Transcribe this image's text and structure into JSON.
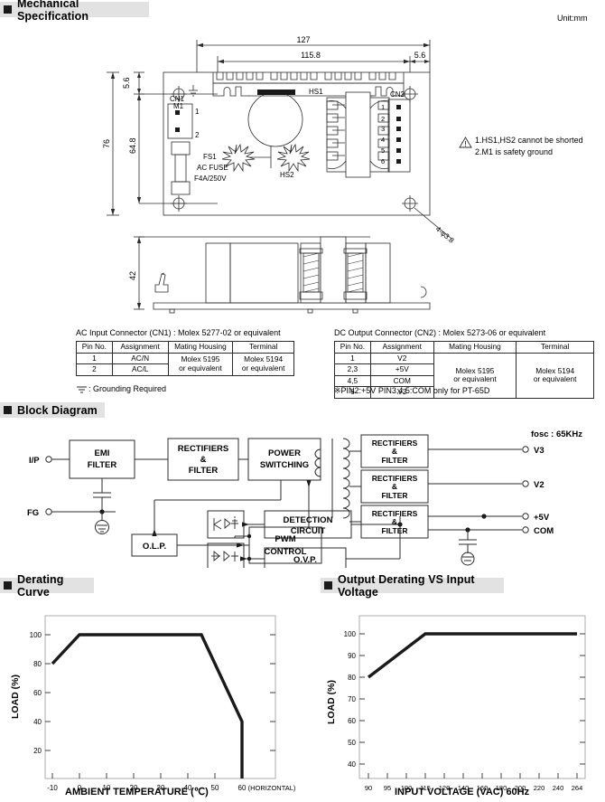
{
  "sections": {
    "mechanical": "Mechanical Specification",
    "block": "Block Diagram",
    "derating": "Derating Curve",
    "output_derating": "Output Derating VS Input Voltage"
  },
  "mechanical": {
    "unit_note": "Unit:mm",
    "dimensions": {
      "overall_width": "127",
      "inner_width": "115.8",
      "right_offset": "5.6",
      "top_offset": "5.6",
      "overall_height": "76",
      "inner_height": "64.8",
      "side_height": "42"
    },
    "labels": {
      "m1": "M1",
      "hs1": "HS1",
      "hs2": "HS2",
      "cn1": "CN1",
      "cn2": "CN2",
      "fs1": "FS1",
      "fuse_line1": "AC FUSE",
      "fuse_line2": "F4A/250V",
      "hole_callout": "4-φ3.8"
    },
    "cn1_pins": [
      "1",
      "2"
    ],
    "cn2_pins": [
      "1",
      "2",
      "3",
      "4",
      "5",
      "6"
    ],
    "warnings": [
      "1.HS1,HS2 cannot be shorted",
      "2.M1 is safety ground"
    ]
  },
  "cn1_table": {
    "caption": "AC Input Connector (CN1) : Molex 5277-02  or equivalent",
    "headers": [
      "Pin No.",
      "Assignment",
      "Mating Housing",
      "Terminal"
    ],
    "rows": [
      {
        "pin": "1",
        "assignment": "AC/N"
      },
      {
        "pin": "2",
        "assignment": "AC/L"
      }
    ],
    "mating_housing": "Molex 5195\nor equivalent",
    "mating_housing_l1": "Molex 5195",
    "mating_housing_l2": "or equivalent",
    "terminal_l1": "Molex 5194",
    "terminal_l2": "or equivalent",
    "footnote": ": Grounding Required"
  },
  "cn2_table": {
    "caption": "DC Output Connector (CN2) : Molex 5273-06 or equivalent",
    "headers": [
      "Pin No.",
      "Assignment",
      "Mating Housing",
      "Terminal"
    ],
    "rows": [
      {
        "pin": "1",
        "assignment": "V2"
      },
      {
        "pin": "2,3",
        "assignment": "+5V"
      },
      {
        "pin": "4,5",
        "assignment": "COM"
      },
      {
        "pin": "6",
        "assignment": "V3"
      }
    ],
    "mating_housing_l1": "Molex 5195",
    "mating_housing_l2": "or equivalent",
    "terminal_l1": "Molex 5194",
    "terminal_l2": "or equivalent",
    "footnote": "※PIN2:+5V    PIN3,4,5:COM only for PT-65D"
  },
  "block_diagram": {
    "inputs": [
      {
        "label": "I/P"
      },
      {
        "label": "FG"
      }
    ],
    "blocks": [
      {
        "name": "emi-filter",
        "lines": [
          "EMI",
          "FILTER"
        ]
      },
      {
        "name": "rectifiers-filter-input",
        "lines": [
          "RECTIFIERS",
          "&",
          "FILTER"
        ]
      },
      {
        "name": "power-switching",
        "lines": [
          "POWER",
          "SWITCHING"
        ]
      },
      {
        "name": "rectifiers-filter-v3",
        "lines": [
          "RECTIFIERS",
          "&",
          "FILTER"
        ]
      },
      {
        "name": "rectifiers-filter-v2",
        "lines": [
          "RECTIFIERS",
          "&",
          "FILTER"
        ]
      },
      {
        "name": "rectifiers-filter-5v",
        "lines": [
          "RECTIFIERS",
          "&",
          "FILTER"
        ]
      },
      {
        "name": "olp",
        "lines": [
          "O.L.P."
        ]
      },
      {
        "name": "pwm-control",
        "lines": [
          "PWM",
          "CONTROL"
        ]
      },
      {
        "name": "detection-circuit",
        "lines": [
          "DETECTION",
          "CIRCUIT"
        ]
      },
      {
        "name": "ovp",
        "lines": [
          "O.V.P."
        ]
      }
    ],
    "outputs": [
      {
        "label": "V3"
      },
      {
        "label": "V2"
      },
      {
        "label": "+5V"
      },
      {
        "label": "COM"
      }
    ],
    "fosc": "fosc : 65KHz"
  },
  "chart_data": [
    {
      "type": "line",
      "name": "derating-curve",
      "title": "Derating Curve",
      "xlabel": "AMBIENT TEMPERATURE (℃)",
      "ylabel": "LOAD (%)",
      "xticks": [
        "-10",
        "0",
        "10",
        "20",
        "30",
        "40",
        "50",
        "60"
      ],
      "xtick_values": [
        -10,
        0,
        10,
        20,
        30,
        40,
        50,
        60
      ],
      "yticks": [
        "20",
        "40",
        "60",
        "80",
        "100"
      ],
      "ytick_values": [
        20,
        40,
        60,
        80,
        100
      ],
      "xlim": [
        -14,
        70
      ],
      "ylim": [
        0,
        113
      ],
      "grid": false,
      "annotation": "(HORIZONTAL)",
      "series": [
        {
          "name": "load",
          "points": [
            {
              "x": -10,
              "y": 80
            },
            {
              "x": 0,
              "y": 100
            },
            {
              "x": 45,
              "y": 100
            },
            {
              "x": 60,
              "y": 50
            },
            {
              "x": 60,
              "y": 0
            }
          ]
        }
      ]
    },
    {
      "type": "line",
      "name": "output-derating-vs-input-voltage",
      "title": "Output Derating VS Input Voltage",
      "xlabel": "INPUT VOLTAGE (VAC) 60Hz",
      "ylabel": "LOAD (%)",
      "xticks": [
        "90",
        "95",
        "100",
        "115",
        "120",
        "140",
        "160",
        "180",
        "200",
        "220",
        "240",
        "264"
      ],
      "yticks": [
        "40",
        "50",
        "60",
        "70",
        "80",
        "90",
        "100"
      ],
      "ytick_values": [
        40,
        50,
        60,
        70,
        80,
        90,
        100
      ],
      "ylim": [
        33,
        107
      ],
      "grid": false,
      "series": [
        {
          "name": "load",
          "points": [
            {
              "xcat": "90",
              "y": 80
            },
            {
              "xcat": "115",
              "y": 100
            },
            {
              "xcat": "264",
              "y": 100
            }
          ]
        }
      ]
    }
  ]
}
